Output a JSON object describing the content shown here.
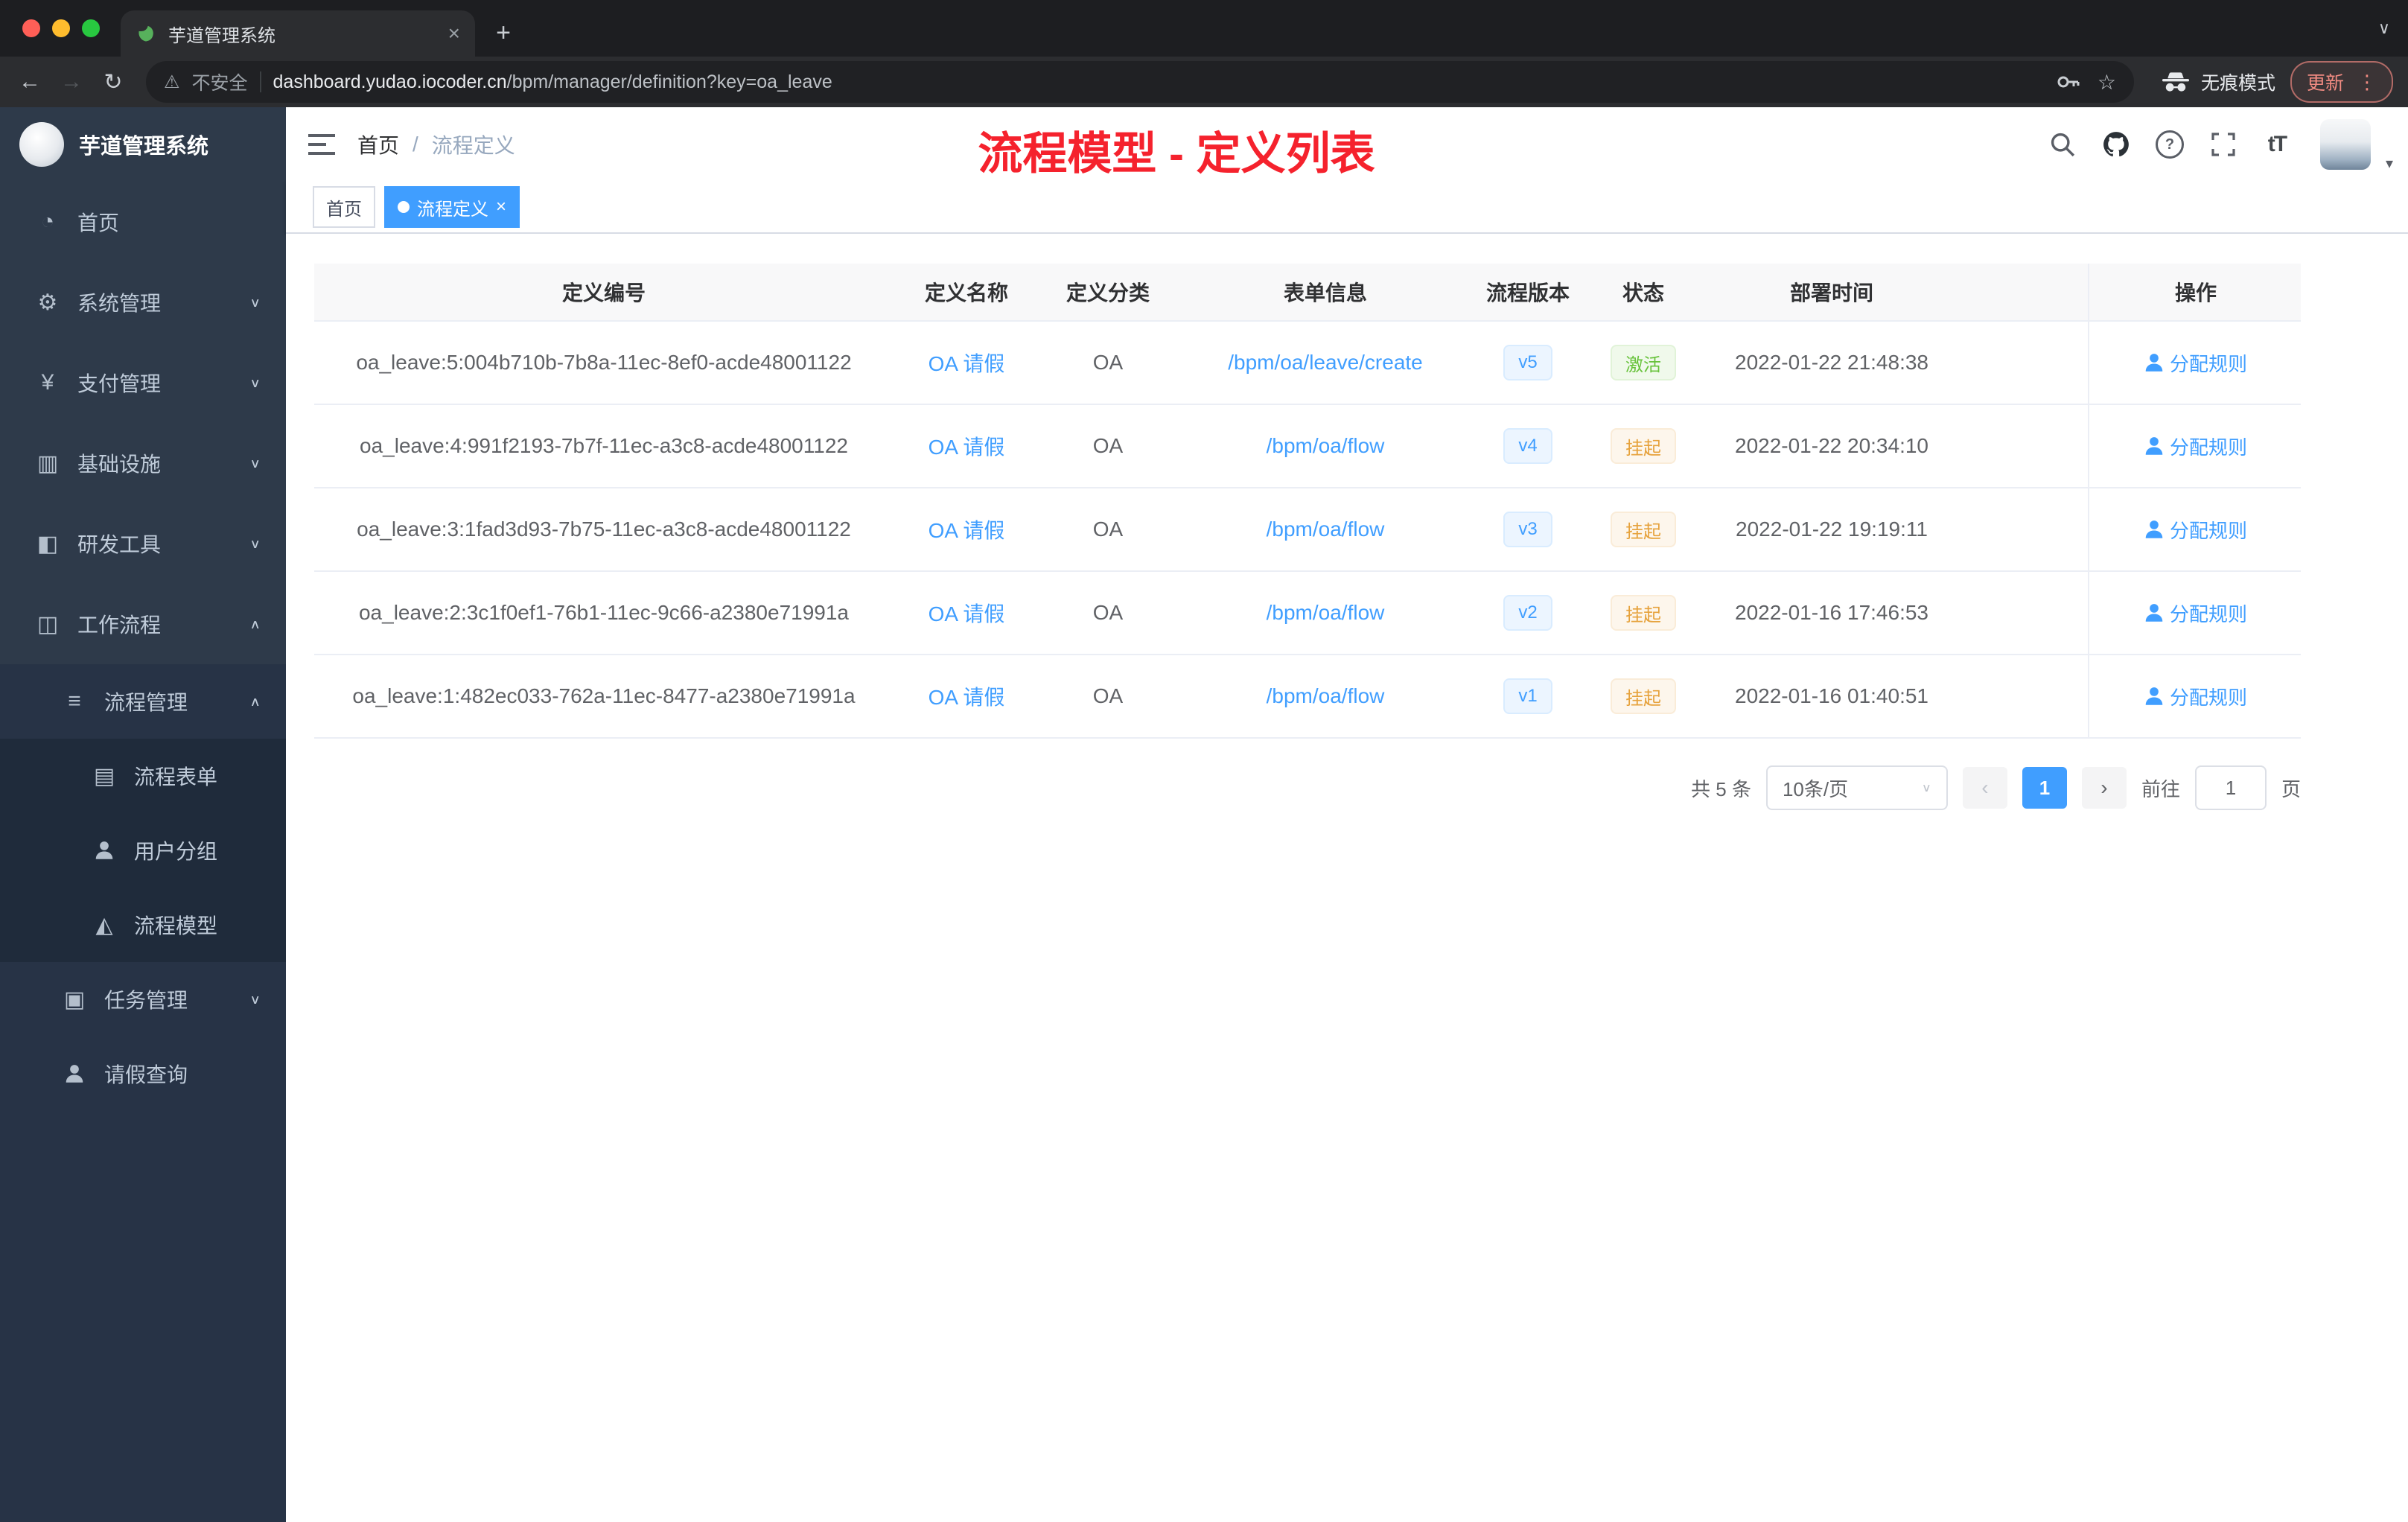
{
  "browser": {
    "tab_title": "芋道管理系统",
    "security_label": "不安全",
    "url_domain": "dashboard.yudao.iocoder.cn",
    "url_path": "/bpm/manager/definition?key=oa_leave",
    "incognito_label": "无痕模式",
    "update_label": "更新",
    "icons": {
      "close": "×",
      "plus": "+",
      "chevron_down": "∨",
      "back": "←",
      "forward": "→",
      "reload": "↻",
      "warning": "⚠",
      "star": "☆",
      "dots": "⋮"
    }
  },
  "sidebar": {
    "logo_title": "芋道管理系统",
    "items": [
      {
        "label": "首页",
        "glyph": "◔"
      },
      {
        "label": "系统管理",
        "glyph": "⚙",
        "arrow": "∨"
      },
      {
        "label": "支付管理",
        "glyph": "¥",
        "arrow": "∨"
      },
      {
        "label": "基础设施",
        "glyph": "▥",
        "arrow": "∨"
      },
      {
        "label": "研发工具",
        "glyph": "◧",
        "arrow": "∨"
      },
      {
        "label": "工作流程",
        "glyph": "◫",
        "arrow": "∧"
      },
      {
        "label": "流程管理",
        "glyph": "≡",
        "arrow": "∧"
      },
      {
        "label": "流程表单",
        "glyph": "▤"
      },
      {
        "label": "用户分组"
      },
      {
        "label": "流程模型",
        "glyph": "◭"
      },
      {
        "label": "任务管理",
        "glyph": "▣",
        "arrow": "∨"
      },
      {
        "label": "请假查询"
      }
    ]
  },
  "header": {
    "breadcrumb_home": "首页",
    "breadcrumb_sep": "/",
    "breadcrumb_current": "流程定义",
    "annotation": "流程模型 - 定义列表",
    "question_glyph": "?",
    "font_size_glyph": "tT",
    "avatar_caret": "▾"
  },
  "tags": {
    "home": "首页",
    "active": "流程定义",
    "close": "×"
  },
  "table": {
    "columns": [
      "定义编号",
      "定义名称",
      "定义分类",
      "表单信息",
      "流程版本",
      "状态",
      "部署时间",
      "操作"
    ],
    "rows": [
      {
        "id": "oa_leave:5:004b710b-7b8a-11ec-8ef0-acde48001122",
        "name": "OA 请假",
        "category": "OA",
        "form": "/bpm/oa/leave/create",
        "version": "v5",
        "status": "激活",
        "deployed_at": "2022-01-22 21:48:38",
        "action": "分配规则"
      },
      {
        "id": "oa_leave:4:991f2193-7b7f-11ec-a3c8-acde48001122",
        "name": "OA 请假",
        "category": "OA",
        "form": "/bpm/oa/flow",
        "version": "v4",
        "status": "挂起",
        "deployed_at": "2022-01-22 20:34:10",
        "action": "分配规则"
      },
      {
        "id": "oa_leave:3:1fad3d93-7b75-11ec-a3c8-acde48001122",
        "name": "OA 请假",
        "category": "OA",
        "form": "/bpm/oa/flow",
        "version": "v3",
        "status": "挂起",
        "deployed_at": "2022-01-22 19:19:11",
        "action": "分配规则"
      },
      {
        "id": "oa_leave:2:3c1f0ef1-76b1-11ec-9c66-a2380e71991a",
        "name": "OA 请假",
        "category": "OA",
        "form": "/bpm/oa/flow",
        "version": "v2",
        "status": "挂起",
        "deployed_at": "2022-01-16 17:46:53",
        "action": "分配规则"
      },
      {
        "id": "oa_leave:1:482ec033-762a-11ec-8477-a2380e71991a",
        "name": "OA 请假",
        "category": "OA",
        "form": "/bpm/oa/flow",
        "version": "v1",
        "status": "挂起",
        "deployed_at": "2022-01-16 01:40:51",
        "action": "分配规则"
      }
    ]
  },
  "pagination": {
    "total": "共 5 条",
    "page_size": "10条/页",
    "select_caret": "∨",
    "prev": "‹",
    "page": "1",
    "next": "›",
    "goto_label": "前往",
    "goto_value": "1",
    "unit": "页"
  },
  "colors": {
    "accent": "#409eff",
    "success": "#67c23a",
    "warning": "#e6a23c",
    "annotation_red": "#f5222d",
    "sidebar_bg": "#2e3a4a"
  }
}
